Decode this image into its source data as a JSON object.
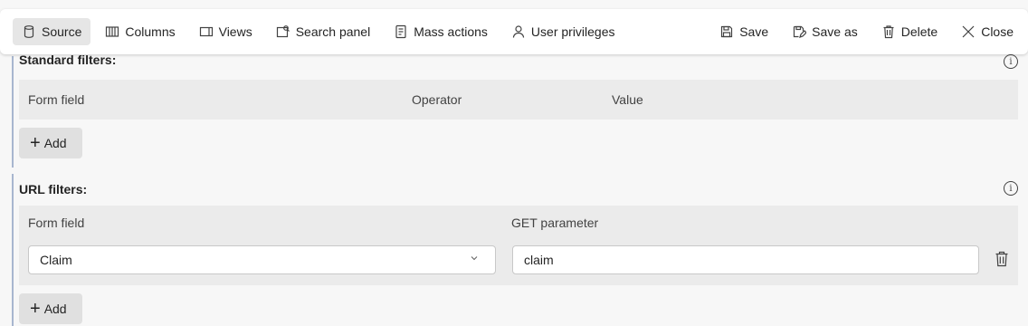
{
  "toolbar": {
    "left": [
      {
        "label": "Source",
        "icon": "database-icon",
        "active": true
      },
      {
        "label": "Columns",
        "icon": "columns-icon"
      },
      {
        "label": "Views",
        "icon": "views-icon"
      },
      {
        "label": "Search panel",
        "icon": "search-panel-icon"
      },
      {
        "label": "Mass actions",
        "icon": "mass-actions-icon"
      },
      {
        "label": "User privileges",
        "icon": "person-icon"
      }
    ],
    "right": [
      {
        "label": "Save",
        "icon": "save-icon"
      },
      {
        "label": "Save as",
        "icon": "save-as-icon"
      },
      {
        "label": "Delete",
        "icon": "trash-icon"
      },
      {
        "label": "Close",
        "icon": "close-icon"
      }
    ]
  },
  "standard_filters": {
    "title": "Standard filters:",
    "columns": [
      "Form field",
      "Operator",
      "Value"
    ],
    "add_label": "Add"
  },
  "url_filters": {
    "title": "URL filters:",
    "columns": [
      "Form field",
      "GET parameter"
    ],
    "rows": [
      {
        "form_field": "Claim",
        "get_parameter": "claim"
      }
    ],
    "add_label": "Add"
  }
}
